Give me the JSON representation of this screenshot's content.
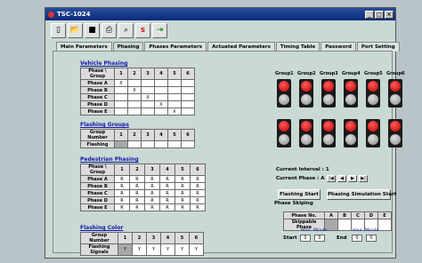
{
  "window": {
    "title": "TSC-1024"
  },
  "tabs": [
    "Main Parameters",
    "Phasing",
    "Phases Parameters",
    "Actuated Parameters",
    "Timing Table",
    "Password",
    "Port Setting"
  ],
  "vehicle_phasing": {
    "title": "Vehicle Phasing",
    "header": [
      "Phase \\ Group",
      "1",
      "2",
      "3",
      "4",
      "5",
      "6"
    ],
    "rows": [
      [
        "Phase A",
        "X",
        "",
        "",
        "",
        "",
        ""
      ],
      [
        "Phase B",
        "",
        "X",
        "",
        "",
        "",
        ""
      ],
      [
        "Phase C",
        "",
        "",
        "X",
        "",
        "",
        ""
      ],
      [
        "Phase D",
        "",
        "",
        "",
        "X",
        "",
        ""
      ],
      [
        "Phase E",
        "",
        "",
        "",
        "",
        "X",
        ""
      ]
    ]
  },
  "flashing_groups": {
    "title": "Flashing Groups",
    "header": [
      "Group Number",
      "1",
      "2",
      "3",
      "4",
      "5",
      "6"
    ],
    "row_label": "Flashing"
  },
  "pedestrian_phasing": {
    "title": "Pedestrian Phasing",
    "header": [
      "Phase \\ Group",
      "1",
      "2",
      "3",
      "4",
      "5",
      "6"
    ],
    "rows": [
      [
        "Phase A",
        "R",
        "R",
        "R",
        "R",
        "R",
        "R"
      ],
      [
        "Phase B",
        "R",
        "R",
        "R",
        "R",
        "R",
        "R"
      ],
      [
        "Phase C",
        "R",
        "R",
        "R",
        "R",
        "R",
        "R"
      ],
      [
        "Phase D",
        "R",
        "R",
        "R",
        "R",
        "R",
        "R"
      ],
      [
        "Phase E",
        "R",
        "R",
        "R",
        "R",
        "R",
        "R"
      ]
    ]
  },
  "flashing_color": {
    "title": "Flashing Color",
    "header": [
      "Group Number",
      "1",
      "2",
      "3",
      "4",
      "5",
      "6"
    ],
    "row": [
      "Flashing Signals",
      "Y",
      "Y",
      "Y",
      "Y",
      "Y",
      "Y"
    ]
  },
  "groups": [
    "Group1",
    "Group2",
    "Group3",
    "Group4",
    "Group5",
    "Group6"
  ],
  "status": {
    "interval_label": "Current Interval :",
    "interval_value": "1",
    "phase_label": "Current Phase :",
    "phase_value": "A"
  },
  "buttons": {
    "flashing_start": "Flashing Start",
    "phasing_sim_start": "Phasing Simulation Start"
  },
  "phase_skipping": {
    "title": "Phase Skiping",
    "header": [
      "Phase No.",
      "A",
      "B",
      "C",
      "D",
      "E"
    ],
    "row_label": "Skippable Phase",
    "start_label": "Start",
    "end_label": "End",
    "hour_label": "Hour",
    "minute_label": "Minute",
    "start_hour": "0",
    "start_minute": "0",
    "end_hour": "0",
    "end_minute": "0"
  },
  "colors": {
    "title_bar": "#0a2a7a",
    "section_title": "#1515a8",
    "red_light": "#c00000"
  }
}
